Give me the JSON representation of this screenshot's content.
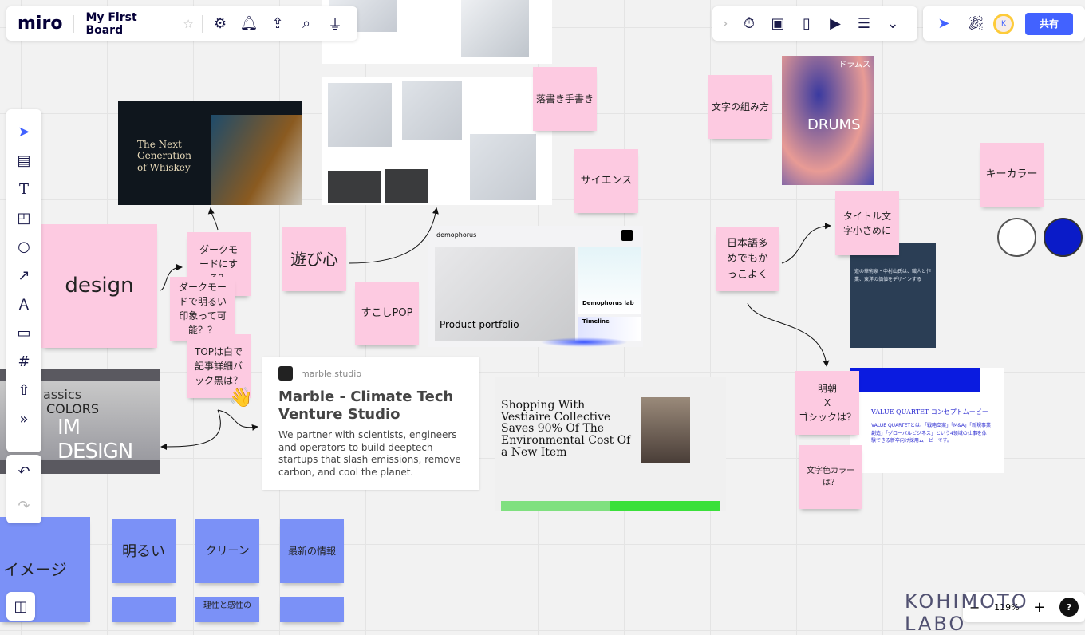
{
  "topbar": {
    "logo": "miro",
    "board_title": "My First Board"
  },
  "right_toolbar": {
    "share_label": "共有",
    "avatar_initial": "K"
  },
  "zoom": {
    "level": "119%",
    "minus": "−",
    "plus": "+",
    "help": "?"
  },
  "watermark": "KOHIMOTO LABO",
  "colors": {
    "accent": "#4262ff",
    "sticky_pink": "#fdcae1",
    "sticky_blue": "#7b91f7",
    "key_white": "#ffffff",
    "key_blue": "#0a1bc8"
  },
  "stickies": {
    "design": "design",
    "dark1": "ダークモードにする？",
    "dark2": "ダークモードで明るい印象って可能？？",
    "top": "TOPは白で記事詳細バック黒は？",
    "asobi": "遊び心",
    "pop": "すこしPOP",
    "rakugaki": "落書き手書き",
    "science": "サイエンス",
    "moji": "文字の組み方",
    "nihongo": "日本語多めでもかっこよく",
    "title_small": "タイトル文字小さめに",
    "key_color": "キーカラー",
    "mincho": "明朝\nX\nゴシックは？",
    "moji_color": "文字色カラーは？",
    "image": "イメージ",
    "akarui": "明るい",
    "clean": "クリーン",
    "latest": "最新の情報",
    "risei": "理性と感性の"
  },
  "cards": {
    "whiskey": {
      "title": "The Next Generation of Whiskey"
    },
    "denim": {
      "title": "IM DESIGN",
      "sub": "COLORS",
      "top": "assics"
    },
    "marble": {
      "site": "marble.studio",
      "title": "Marble - Climate Tech Venture Studio",
      "desc": "We partner with scientists, engineers and operators to build deeptech startups that slash emissions, remove carbon, and cool the planet."
    },
    "demophorus": {
      "brand": "demophorus",
      "main": "Product portfolio",
      "lab": "Demophorus lab",
      "timeline": "Timeline"
    },
    "vestiaire": {
      "brand": "Vestiaire Collective",
      "headline": "Shopping With Vestiaire Collective Saves 90% Of The Environmental Cost Of a New Item"
    },
    "drums": {
      "kana": "ドラムス",
      "title": "DRUMS"
    },
    "value": {
      "title": "VALUE QUARTET コンセプトムービー",
      "desc": "VALUE QUARTETとは、「戦略立案」「M&A」「新規事業創造」「グローバルビジネス」という4領域の仕事を体験できる新卒向け採用ムービーです。"
    },
    "dark_card": {
      "text": "道の華術家・中村山氏は、職人と作業、東洋の価値をデザインする"
    }
  }
}
